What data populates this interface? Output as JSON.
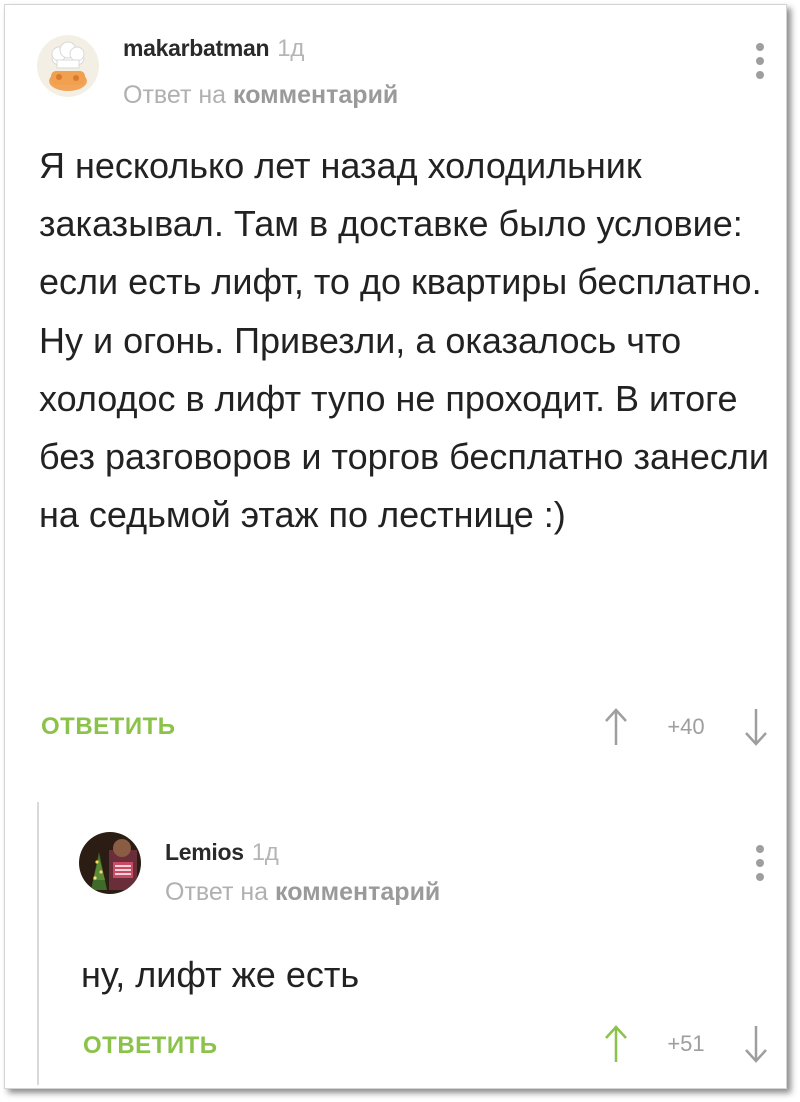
{
  "comments": [
    {
      "author": "makarbatman",
      "time": "1д",
      "reply_prefix": "Ответ на",
      "reply_target": "комментарий",
      "text": "Я несколько лет назад холодильник заказывал. Там в доставке было условие: если есть лифт, то до квартиры бесплатно. Ну и огонь. Привезли, а оказалось что холодос в лифт тупо не проходит. В итоге без разговоров и торгов бесплатно занесли на седьмой этаж по лестнице :)",
      "reply_label": "ОТВЕТИТЬ",
      "score": "+40",
      "upvoted": false
    },
    {
      "author": "Lemios",
      "time": "1д",
      "reply_prefix": "Ответ на",
      "reply_target": "комментарий",
      "text": "ну, лифт же есть",
      "reply_label": "ОТВЕТИТЬ",
      "score": "+51",
      "upvoted": true
    }
  ],
  "colors": {
    "accent_green": "#8bc34a",
    "muted_gray": "#9e9e9e",
    "text": "#222222"
  },
  "icons": {
    "avatar_1": "chef-hat-avatar-icon",
    "avatar_2": "photo-avatar-icon",
    "upvote": "arrow-up-icon",
    "downvote": "arrow-down-icon",
    "menu": "more-vertical-icon"
  }
}
